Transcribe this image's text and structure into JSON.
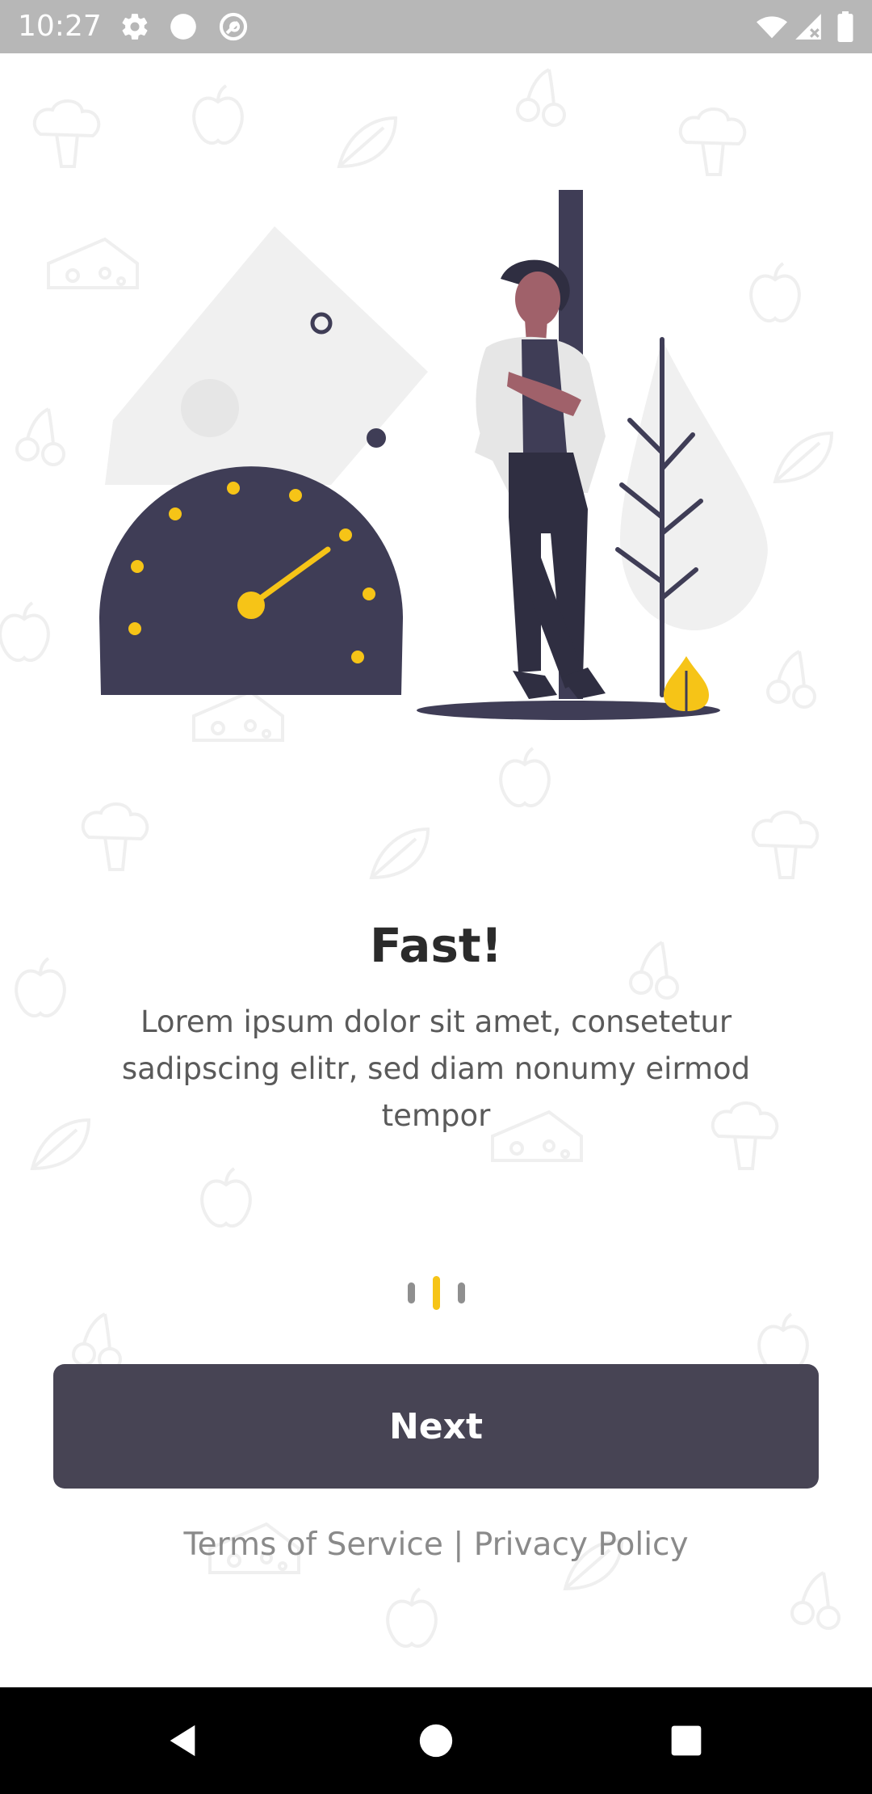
{
  "status_bar": {
    "time": "10:27",
    "left_icons": [
      "gear-icon",
      "circle-icon",
      "at-sign-icon"
    ],
    "right_icons": [
      "wifi-icon",
      "cellular-signal-icon",
      "battery-icon"
    ]
  },
  "onboarding": {
    "title": "Fast!",
    "description": "Lorem ipsum dolor sit amet, consetetur sadipscing elitr, sed diam nonumy eirmod tempor",
    "pages_total": 3,
    "active_page_index": 1,
    "next_label": "Next",
    "legal": {
      "terms": "Terms of Service",
      "separator": "|",
      "privacy": "Privacy Policy"
    }
  },
  "nav_bar": {
    "buttons": [
      "back-icon",
      "home-icon",
      "recents-icon"
    ]
  },
  "colors": {
    "accent": "#f6c417",
    "button": "#474454",
    "dark_ink": "#3f3d56",
    "status_bar": "#b7b7b7"
  }
}
